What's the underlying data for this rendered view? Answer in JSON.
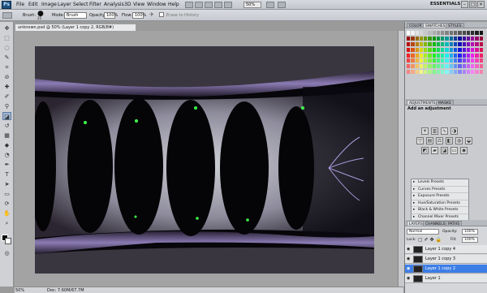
{
  "menubar": {
    "items": [
      "File",
      "Edit",
      "Image",
      "Layer",
      "Select",
      "Filter",
      "Analysis",
      "3D",
      "View",
      "Window",
      "Help"
    ],
    "zoom": "50%",
    "workspace": "ESSENTIALS ▾"
  },
  "options": {
    "brush_label": "Brush:",
    "brush_size": "25",
    "mode_label": "Mode:",
    "mode_value": "Brush",
    "opacity_label": "Opacity:",
    "opacity_value": "100%",
    "flow_label": "Flow:",
    "flow_value": "100%",
    "erase_history": "Erase to History"
  },
  "document": {
    "tab_title": "unknown.psd @ 50% (Layer 1 copy 2, RGB/8#)",
    "zoom": "50%",
    "doc_info": "Doc: 7.60M/67.7M"
  },
  "panels": {
    "color_tabs": [
      "COLOR",
      "SWATCHES",
      "STYLES"
    ],
    "adj_tabs": [
      "ADJUSTMENTS",
      "MASKS"
    ],
    "adj_title": "Add an adjustment",
    "presets": [
      "Levels Presets",
      "Curves Presets",
      "Exposure Presets",
      "Hue/Saturation Presets",
      "Black & White Presets",
      "Channel Mixer Presets",
      "Selective Color Presets"
    ],
    "layer_tabs": [
      "LAYERS",
      "CHANNELS",
      "PATHS"
    ],
    "blend_mode": "Normal",
    "opacity_label": "Opacity:",
    "opacity_value": "100%",
    "lock_label": "Lock:",
    "fill_label": "Fill:",
    "fill_value": "100%",
    "layers": [
      {
        "name": "Layer 1 copy 4"
      },
      {
        "name": "Layer 1 copy 3"
      },
      {
        "name": "Layer 1 copy 2",
        "selected": true
      },
      {
        "name": "Layer 1"
      }
    ]
  },
  "colors": {
    "accent": "#3d7ee6"
  }
}
